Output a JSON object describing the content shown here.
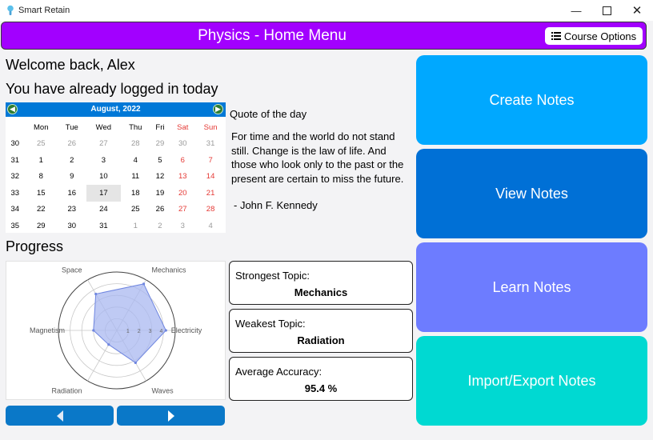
{
  "window": {
    "title": "Smart Retain"
  },
  "header": {
    "title": "Physics - Home Menu",
    "course_options_label": "Course Options"
  },
  "welcome": {
    "greeting": "Welcome back, Alex",
    "login_status": "You have already logged in today"
  },
  "calendar": {
    "month_label": "August, 2022",
    "weekdays": [
      "Mon",
      "Tue",
      "Wed",
      "Thu",
      "Fri",
      "Sat",
      "Sun"
    ],
    "weeks": [
      {
        "week": "30",
        "days": [
          "25",
          "26",
          "27",
          "28",
          "29",
          "30",
          "31"
        ]
      },
      {
        "week": "31",
        "days": [
          "1",
          "2",
          "3",
          "4",
          "5",
          "6",
          "7"
        ]
      },
      {
        "week": "32",
        "days": [
          "8",
          "9",
          "10",
          "11",
          "12",
          "13",
          "14"
        ]
      },
      {
        "week": "33",
        "days": [
          "15",
          "16",
          "17",
          "18",
          "19",
          "20",
          "21"
        ]
      },
      {
        "week": "34",
        "days": [
          "22",
          "23",
          "24",
          "25",
          "26",
          "27",
          "28"
        ]
      },
      {
        "week": "35",
        "days": [
          "29",
          "30",
          "31",
          "1",
          "2",
          "3",
          "4"
        ]
      }
    ],
    "selected_day": "17",
    "weekend_color": "#e53935"
  },
  "quote": {
    "heading": "Quote of the day",
    "lines": [
      "For time and the world do not stand",
      "still. Change is the law of life. And",
      "those who look only to the past or the",
      "present are certain to miss the future."
    ],
    "author": "- John F. Kennedy"
  },
  "progress": {
    "heading": "Progress",
    "prev_icon": "left-triangle-icon",
    "next_icon": "right-triangle-icon"
  },
  "chart_data": {
    "type": "radar",
    "categories": [
      "Mechanics",
      "Electricity",
      "Waves",
      "Radiation",
      "Magnetism",
      "Space"
    ],
    "values": [
      4.6,
      4.2,
      3.2,
      1.4,
      2.0,
      3.6
    ],
    "rlim": [
      0,
      5
    ],
    "tick_labels": [
      "1",
      "2",
      "3",
      "4"
    ],
    "fill_color": "#aab8f0",
    "line_color": "#6f86e0"
  },
  "stats": {
    "strongest": {
      "label": "Strongest Topic:",
      "value": "Mechanics"
    },
    "weakest": {
      "label": "Weakest Topic:",
      "value": "Radiation"
    },
    "accuracy": {
      "label": "Average Accuracy:",
      "value": "95.4 %"
    }
  },
  "actions": [
    {
      "label": "Create Notes",
      "color": "#00a8ff"
    },
    {
      "label": "View Notes",
      "color": "#0070d6"
    },
    {
      "label": "Learn Notes",
      "color": "#6d7cff"
    },
    {
      "label": "Import/Export Notes",
      "color": "#00d9d2"
    }
  ]
}
